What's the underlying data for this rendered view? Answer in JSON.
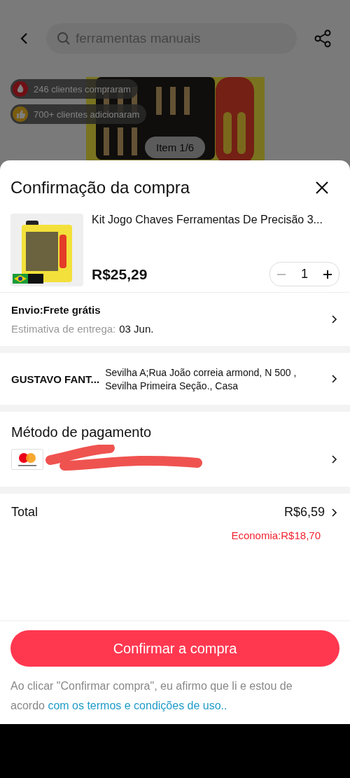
{
  "background_page": {
    "search": {
      "placeholder": "ferramentas manuais"
    },
    "badges": [
      {
        "kind": "fire",
        "text": "246 clientes compraram"
      },
      {
        "kind": "thumb",
        "text": "700+ clientes adicionaram"
      }
    ],
    "image_counter": "Item 1/6"
  },
  "sheet": {
    "title": "Confirmação da compra",
    "product": {
      "name": "Kit Jogo Chaves Ferramentas De Precisão 3...",
      "price": "R$25,29",
      "quantity": "1",
      "decrease_disabled": true
    },
    "shipping": {
      "label": "Envio:Frete grátis",
      "estimate_label": "Estimativa de entrega:",
      "estimate_date": "03 Jun."
    },
    "address": {
      "name": "GUSTAVO FANT...",
      "lines": [
        "Sevilha A;Rua João correia armond,  N 500 ,",
        "Sevilha Primeira Seção., Casa"
      ]
    },
    "payment": {
      "title": "Método de pagamento"
    },
    "total": {
      "label": "Total",
      "amount": "R$6,59",
      "savings": "Economia:R$18,70"
    },
    "confirm_button": "Confirmar a compra",
    "terms": {
      "text": "Ao clicar \"Confirmar compra\", eu afirmo que li e estou de acordo",
      "link": "com os termos e condições de uso.."
    }
  }
}
